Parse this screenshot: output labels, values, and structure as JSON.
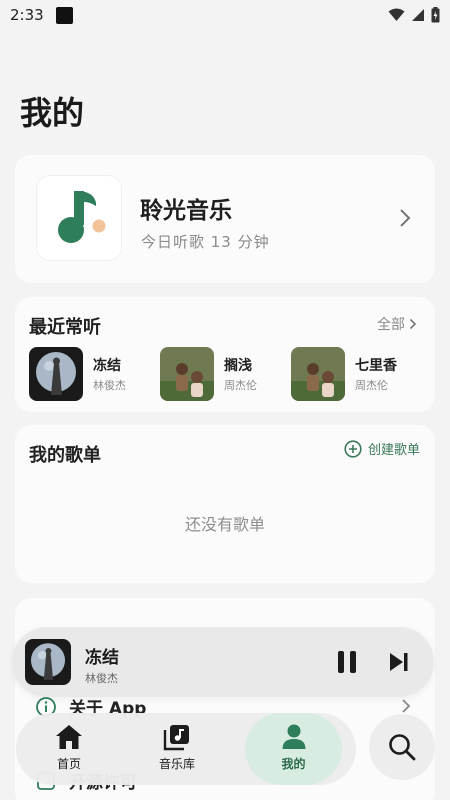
{
  "status_bar": {
    "time": "2:33"
  },
  "page": {
    "title": "我的"
  },
  "profile": {
    "app_name": "聆光音乐",
    "listen_time": "今日听歌 13 分钟"
  },
  "recent": {
    "title": "最近常听",
    "see_all": "全部",
    "items": [
      {
        "song": "冻结",
        "artist": "林俊杰"
      },
      {
        "song": "搁浅",
        "artist": "周杰伦"
      },
      {
        "song": "七里香",
        "artist": "周杰伦"
      }
    ]
  },
  "playlists": {
    "title": "我的歌单",
    "create_label": "创建歌单",
    "empty_text": "还没有歌单"
  },
  "settings": {
    "items": [
      {
        "label": "关于 App",
        "icon": "info-icon"
      },
      {
        "label": "开源许可",
        "icon": "license-icon"
      }
    ]
  },
  "now_playing": {
    "song": "冻结",
    "artist": "林俊杰",
    "state": "playing"
  },
  "nav": {
    "items": [
      {
        "label": "首页",
        "icon": "home-icon"
      },
      {
        "label": "音乐库",
        "icon": "music-library-icon"
      },
      {
        "label": "我的",
        "icon": "profile-icon",
        "active": true
      }
    ]
  },
  "colors": {
    "accent": "#2e7d5b",
    "active_nav_bg": "#d8ece2",
    "background": "#f3f3f3"
  }
}
